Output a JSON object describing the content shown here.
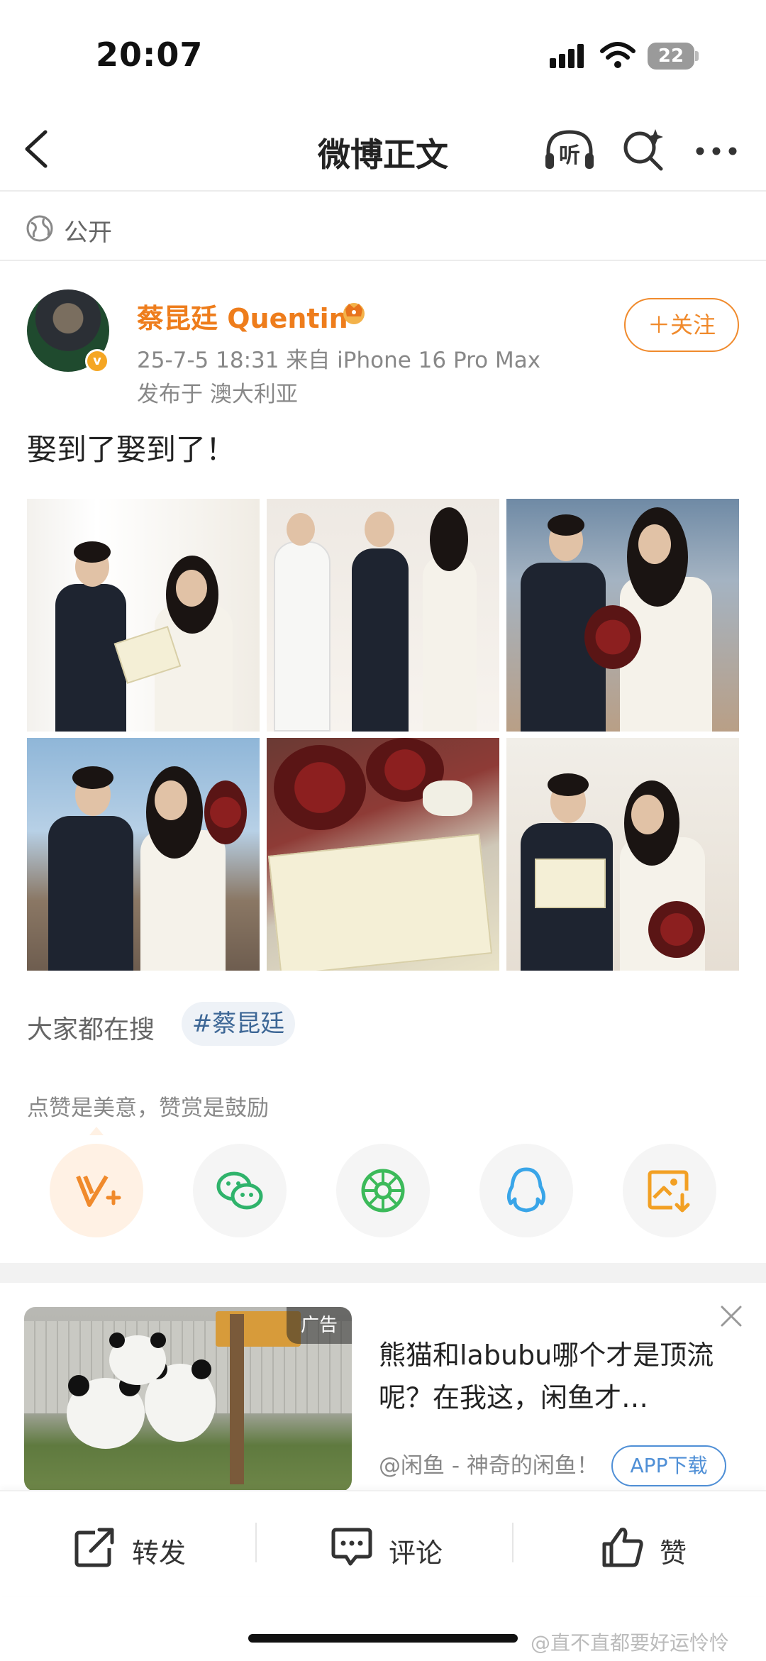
{
  "status_bar": {
    "time": "20:07",
    "battery": "22"
  },
  "nav": {
    "title": "微博正文",
    "listen_label": "听"
  },
  "visibility": {
    "label": "公开"
  },
  "post": {
    "author": "蔡昆廷 Quentin",
    "meta": "25-7-5 18:31  来自 iPhone 16 Pro Max",
    "location": "发布于 澳大利亚",
    "follow_label": "＋关注",
    "text": "娶到了娶到了！",
    "photo_count": 6
  },
  "search": {
    "label": "大家都在搜",
    "tag": "#蔡昆廷"
  },
  "reward_tip": "点赞是美意，赞赏是鼓励",
  "share_icons": [
    "reward-icon",
    "wechat-icon",
    "moments-icon",
    "qq-icon",
    "save-image-icon"
  ],
  "ad": {
    "badge": "广告",
    "title": "熊猫和labubu哪个才是顶流呢？在我这，闲鱼才…",
    "source": "@闲鱼 - 神奇的闲鱼！",
    "download_label": "APP下载"
  },
  "toolbar": {
    "repost": "转发",
    "comment": "评论",
    "like": "赞"
  },
  "watermark": "@直不直都要好运怜怜",
  "colors": {
    "accent_orange": "#ee7d1c",
    "link_blue": "#3d6796",
    "ad_blue": "#4f8fd6"
  }
}
